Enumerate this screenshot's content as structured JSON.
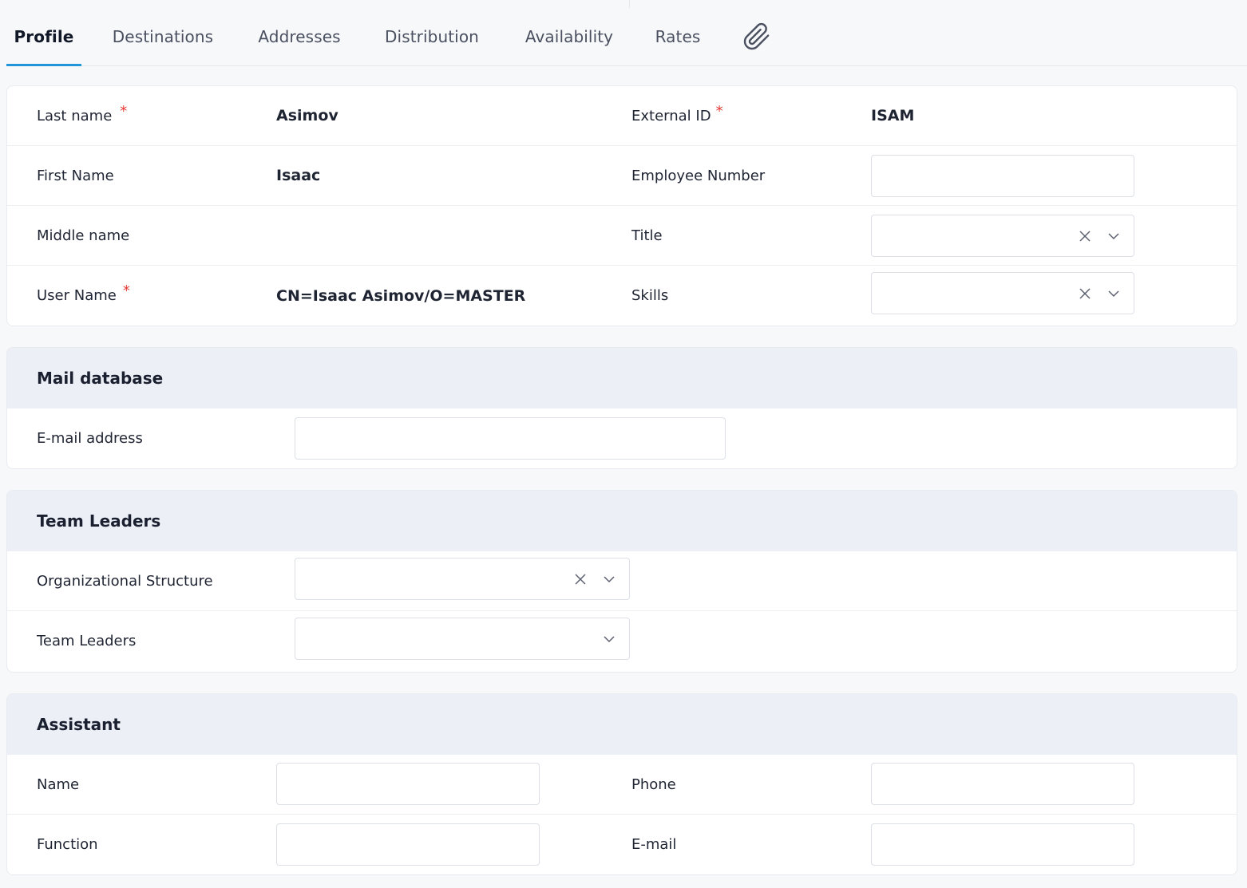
{
  "tabs": [
    {
      "label": "Profile",
      "active": true
    },
    {
      "label": "Destinations",
      "active": false
    },
    {
      "label": "Addresses",
      "active": false
    },
    {
      "label": "Distribution",
      "active": false
    },
    {
      "label": "Availability",
      "active": false
    },
    {
      "label": "Rates",
      "active": false
    }
  ],
  "attachment_icon": "paperclip-icon",
  "profile": {
    "last_name_label": "Last name",
    "last_name_value": "Asimov",
    "external_id_label": "External ID",
    "external_id_value": "ISAM",
    "first_name_label": "First Name",
    "first_name_value": "Isaac",
    "employee_number_label": "Employee Number",
    "employee_number_value": "",
    "middle_name_label": "Middle name",
    "middle_name_value": "",
    "title_label": "Title",
    "title_value": "",
    "user_name_label": "User Name",
    "user_name_value": "CN=Isaac Asimov/O=MASTER",
    "skills_label": "Skills",
    "skills_value": "",
    "required_marker": "*"
  },
  "mail_database": {
    "header": "Mail database",
    "email_label": "E-mail address",
    "email_value": ""
  },
  "team_leaders": {
    "header": "Team Leaders",
    "org_structure_label": "Organizational Structure",
    "org_structure_value": "",
    "team_leaders_label": "Team Leaders",
    "team_leaders_value": ""
  },
  "assistant": {
    "header": "Assistant",
    "name_label": "Name",
    "name_value": "",
    "phone_label": "Phone",
    "phone_value": "",
    "function_label": "Function",
    "function_value": "",
    "email_label": "E-mail",
    "email_value": ""
  },
  "colors": {
    "active_tab_underline": "#2196d9",
    "required": "#e53935",
    "section_header_bg": "#eceff6"
  }
}
